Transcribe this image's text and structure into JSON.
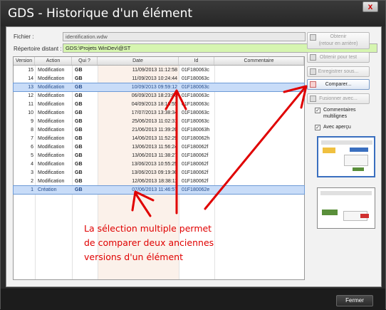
{
  "window": {
    "title": "GDS - Historique d'un élément",
    "close_glyph": "x"
  },
  "fields": {
    "fichier_label": "Fichier :",
    "fichier_value": "identification.wdw",
    "repertoire_label": "Répertoire distant :",
    "repertoire_value": "GDS:\\Projets WinDev\\@ST"
  },
  "table": {
    "headers": [
      "Version",
      "Action",
      "Qui ?",
      "Date",
      "Id",
      "Commentaire"
    ],
    "rows": [
      {
        "version": "15",
        "action": "Modification",
        "who": "GB",
        "date": "11/09/2013 11:12:58",
        "id": "01F180063c",
        "comment": ""
      },
      {
        "version": "14",
        "action": "Modification",
        "who": "GB",
        "date": "11/09/2013 10:24:44",
        "id": "01F180063c",
        "comment": ""
      },
      {
        "version": "13",
        "action": "Modification",
        "who": "GB",
        "date": "10/09/2013 09:59:12",
        "id": "01F180063c",
        "comment": ""
      },
      {
        "version": "12",
        "action": "Modification",
        "who": "GB",
        "date": "06/09/2013 18:23:00",
        "id": "01F180063c",
        "comment": ""
      },
      {
        "version": "11",
        "action": "Modification",
        "who": "GB",
        "date": "04/09/2013 18:16:55",
        "id": "01F180063c",
        "comment": ""
      },
      {
        "version": "10",
        "action": "Modification",
        "who": "GB",
        "date": "17/07/2013 13:38:34",
        "id": "01F180063c",
        "comment": ""
      },
      {
        "version": "9",
        "action": "Modification",
        "who": "GB",
        "date": "25/06/2013 11:02:31",
        "id": "01F180063c",
        "comment": ""
      },
      {
        "version": "8",
        "action": "Modification",
        "who": "GB",
        "date": "21/06/2013 11:39:20",
        "id": "01F180063h",
        "comment": ""
      },
      {
        "version": "7",
        "action": "Modification",
        "who": "GB",
        "date": "14/06/2013 11:52:29",
        "id": "01F180062h",
        "comment": ""
      },
      {
        "version": "6",
        "action": "Modification",
        "who": "GB",
        "date": "13/06/2013 11:56:24",
        "id": "01F180062f",
        "comment": ""
      },
      {
        "version": "5",
        "action": "Modification",
        "who": "GB",
        "date": "13/06/2013 11:38:27",
        "id": "01F180062f",
        "comment": ""
      },
      {
        "version": "4",
        "action": "Modification",
        "who": "GB",
        "date": "13/06/2013 10:55:25",
        "id": "01F180062f",
        "comment": ""
      },
      {
        "version": "3",
        "action": "Modification",
        "who": "GB",
        "date": "13/06/2013 09:19:30",
        "id": "01F180062f",
        "comment": ""
      },
      {
        "version": "2",
        "action": "Modification",
        "who": "GB",
        "date": "12/06/2013 18:38:11",
        "id": "01F180062f",
        "comment": ""
      },
      {
        "version": "1",
        "action": "Création",
        "who": "GB",
        "date": "07/06/2013 11:46:57",
        "id": "01F180062e",
        "comment": ""
      }
    ],
    "selected_versions": [
      "13",
      "1"
    ]
  },
  "buttons": {
    "obtenir": "Obtenir",
    "obtenir_sub": "(retour en arrière)",
    "obtenir_test": "Obtenir pour test",
    "enregistrer": "Enregistrer sous...",
    "comparer": "Comparer...",
    "fusionner": "Fusionner avec..."
  },
  "options": {
    "commentaires_label": "Commentaires",
    "commentaires_label2": "multilignes",
    "commentaires_checked": "✓",
    "apercu_label": "Avec aperçu",
    "apercu_checked": "✓"
  },
  "annotation": {
    "line1": "La sélection multiple permet",
    "line2": "de comparer deux anciennes",
    "line3": "versions d'un élément",
    "color": "#e00000"
  },
  "footer": {
    "close_label": "Fermer"
  }
}
